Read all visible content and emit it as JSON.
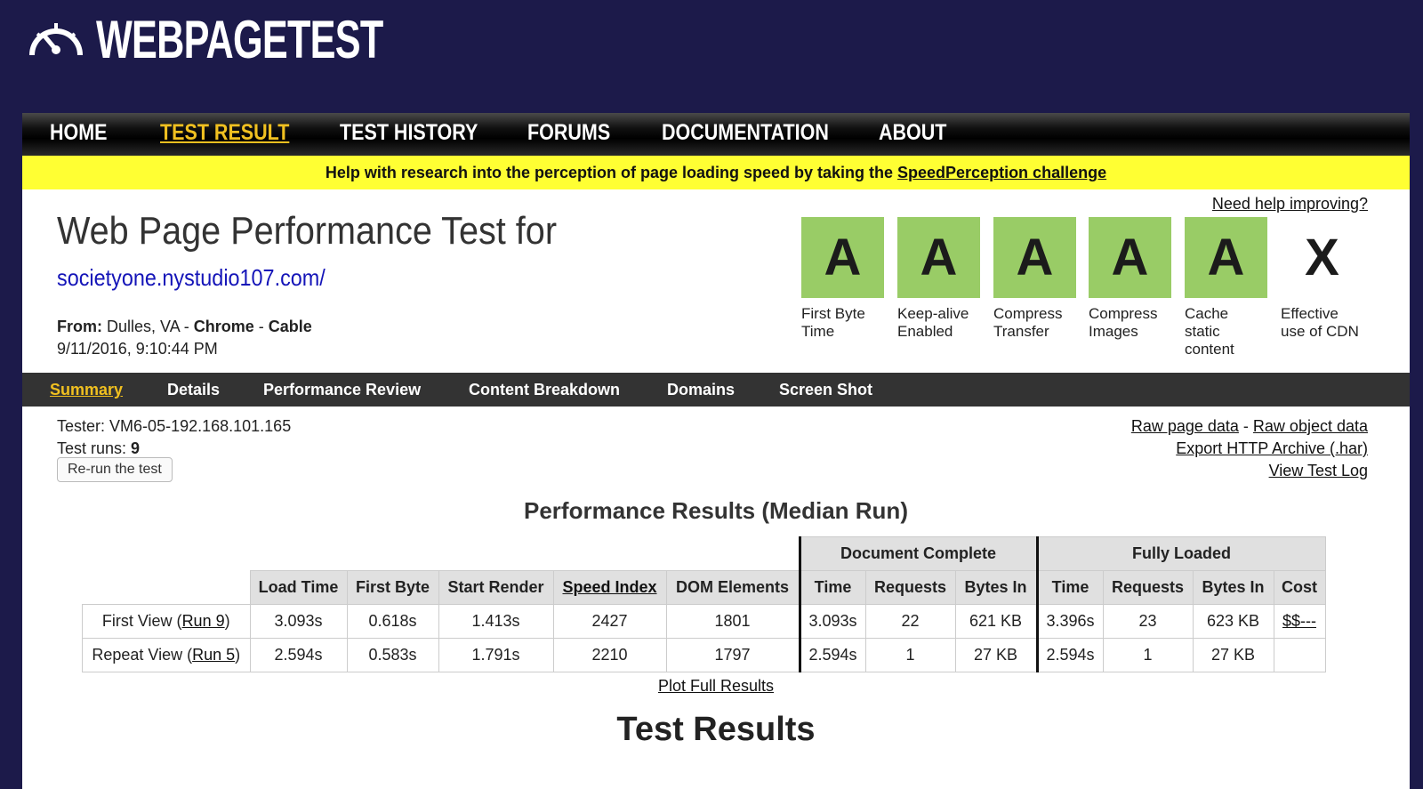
{
  "brand": {
    "logo_text": "WEBPAGETEST",
    "logo_icon": "speedometer-icon"
  },
  "topnav": [
    "HOME",
    "TEST RESULT",
    "TEST HISTORY",
    "FORUMS",
    "DOCUMENTATION",
    "ABOUT"
  ],
  "topnav_active": "TEST RESULT",
  "banner": {
    "text": "Help with research into the perception of page loading speed by taking the ",
    "link": "SpeedPerception challenge"
  },
  "header": {
    "title": "Web Page Performance Test for",
    "url": "societyone.nystudio107.com/",
    "from_label": "From:",
    "location": "Dulles, VA",
    "separator": " - ",
    "browser": "Chrome",
    "connection": "Cable",
    "datetime": "9/11/2016, 9:10:44 PM",
    "help_link": "Need help improving?"
  },
  "grades": [
    {
      "grade": "A",
      "label": "First Byte Time"
    },
    {
      "grade": "A",
      "label": "Keep-alive Enabled"
    },
    {
      "grade": "A",
      "label": "Compress Transfer"
    },
    {
      "grade": "A",
      "label": "Compress Images"
    },
    {
      "grade": "A",
      "label": "Cache static content"
    },
    {
      "grade": "X",
      "label": "Effective use of CDN"
    }
  ],
  "grade_color": "#99cc66",
  "subnav": [
    "Summary",
    "Details",
    "Performance Review",
    "Content Breakdown",
    "Domains",
    "Screen Shot"
  ],
  "subnav_active": "Summary",
  "tester": {
    "tester_label": "Tester:",
    "tester_value": "VM6-05-192.168.101.165",
    "runs_label": "Test runs:",
    "runs_value": "9",
    "rerun_button": "Re-run the test"
  },
  "raw_links": {
    "raw_page": "Raw page data",
    "separator": " - ",
    "raw_object": "Raw object data",
    "har": "Export HTTP Archive (.har)",
    "log": "View Test Log"
  },
  "performance": {
    "title": "Performance Results (Median Run)",
    "group_headers": {
      "document": "Document Complete",
      "fully": "Fully Loaded"
    },
    "columns": [
      "Load Time",
      "First Byte",
      "Start Render",
      "Speed Index",
      "DOM Elements",
      "Time",
      "Requests",
      "Bytes In",
      "Time",
      "Requests",
      "Bytes In",
      "Cost"
    ],
    "rows": [
      {
        "label_prefix": "First View (",
        "run_link": "Run 9",
        "label_suffix": ")",
        "cells": [
          "3.093s",
          "0.618s",
          "1.413s",
          "2427",
          "1801",
          "3.093s",
          "22",
          "621 KB",
          "3.396s",
          "23",
          "623 KB",
          "$$---"
        ]
      },
      {
        "label_prefix": "Repeat View (",
        "run_link": "Run 5",
        "label_suffix": ")",
        "cells": [
          "2.594s",
          "0.583s",
          "1.791s",
          "2210",
          "1797",
          "2.594s",
          "1",
          "27 KB",
          "2.594s",
          "1",
          "27 KB",
          ""
        ]
      }
    ],
    "plot_link": "Plot Full Results"
  },
  "test_results_heading": "Test Results"
}
